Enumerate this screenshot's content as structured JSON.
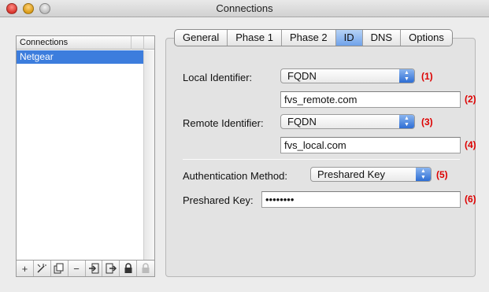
{
  "window": {
    "title": "Connections"
  },
  "connections": {
    "header": "Connections",
    "items": [
      "Netgear"
    ],
    "toolbar_icons": [
      "plus-icon",
      "wand-icon",
      "copy-icon",
      "minus-icon",
      "import-icon",
      "export-icon",
      "lock-icon",
      "lock-disabled-icon"
    ],
    "toolbar_glyphs": [
      "+",
      "✕",
      "⧉",
      "−",
      "⇥",
      "⇨",
      "🔒",
      "🔒"
    ]
  },
  "tabs": [
    "General",
    "Phase 1",
    "Phase 2",
    "ID",
    "DNS",
    "Options"
  ],
  "active_tab": "ID",
  "form": {
    "local_identifier_label": "Local Identifier:",
    "local_identifier_value": "FQDN",
    "local_identifier_num": "(1)",
    "local_field_value": "fvs_remote.com",
    "local_field_num": "(2)",
    "remote_identifier_label": "Remote Identifier:",
    "remote_identifier_value": "FQDN",
    "remote_identifier_num": "(3)",
    "remote_field_value": "fvs_local.com",
    "remote_field_num": "(4)",
    "auth_method_label": "Authentication Method:",
    "auth_method_value": "Preshared Key",
    "auth_method_num": "(5)",
    "preshared_key_label": "Preshared Key:",
    "preshared_key_value": "••••••••",
    "preshared_key_num": "(6)"
  },
  "colors": {
    "accent": "#3c7ddd",
    "annotation": "#dd0000"
  }
}
